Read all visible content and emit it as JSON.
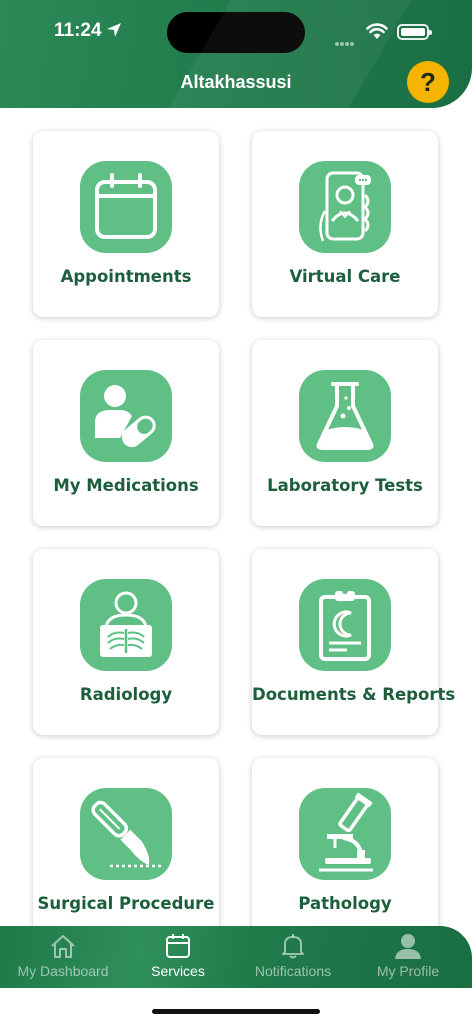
{
  "status_bar": {
    "time": "11:24"
  },
  "header": {
    "title": "Altakhassusi",
    "help_label": "?"
  },
  "services": [
    {
      "label": "Appointments",
      "icon": "calendar-icon"
    },
    {
      "label": "Virtual Care",
      "icon": "doctor-video-call-icon"
    },
    {
      "label": "My Medications",
      "icon": "patient-pill-icon"
    },
    {
      "label": "Laboratory Tests",
      "icon": "flask-icon"
    },
    {
      "label": "Radiology",
      "icon": "xray-icon"
    },
    {
      "label": "Documents & Reports",
      "icon": "clipboard-icon"
    },
    {
      "label": "Surgical Procedure",
      "icon": "scalpel-icon"
    },
    {
      "label": "Pathology",
      "icon": "microscope-icon"
    }
  ],
  "bottom_nav": {
    "items": [
      {
        "label": "My Dashboard",
        "icon": "home-icon",
        "active": false
      },
      {
        "label": "Services",
        "icon": "calendar-icon",
        "active": true
      },
      {
        "label": "Notifications",
        "icon": "bell-icon",
        "active": false
      },
      {
        "label": "My Profile",
        "icon": "person-icon",
        "active": false
      }
    ]
  },
  "colors": {
    "brand_green": "#1f7a4a",
    "icon_tile_green": "#5fbf85",
    "label_green": "#1d5e3c",
    "help_yellow": "#f5b400"
  }
}
